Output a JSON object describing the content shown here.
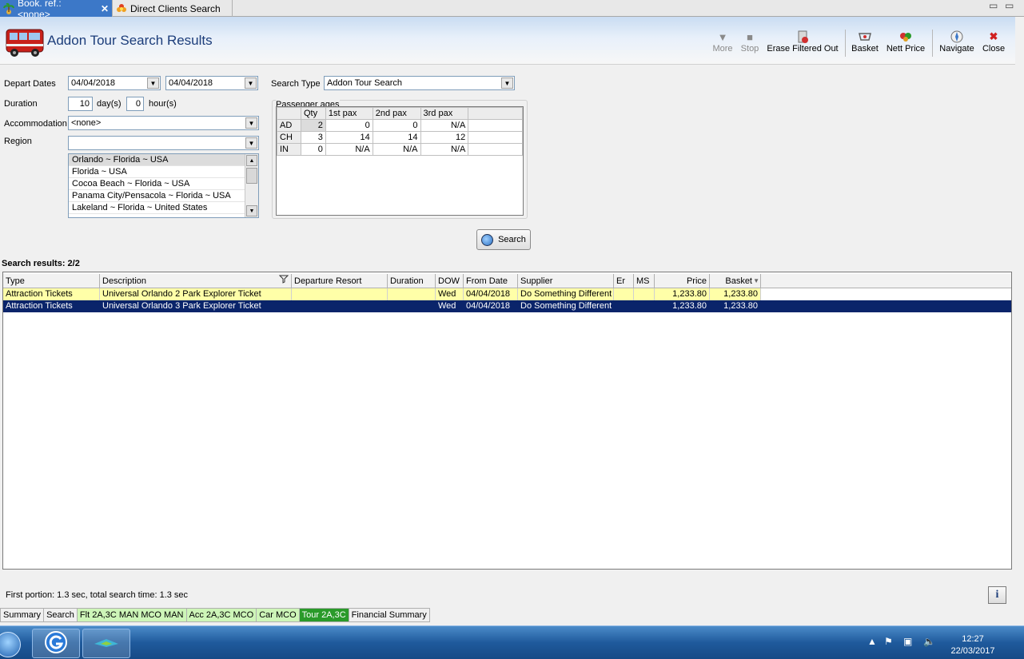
{
  "tabs": [
    {
      "label": "Book. ref.: <none>",
      "close": "✕"
    },
    {
      "label": "Direct Clients Search"
    }
  ],
  "window_controls": {
    "minimize": "▭",
    "restore": "▭"
  },
  "header": {
    "title": "Addon Tour Search Results"
  },
  "toolbar": {
    "more": "More",
    "stop": "Stop",
    "erase": "Erase Filtered Out",
    "basket": "Basket",
    "nett_price": "Nett Price",
    "navigate": "Navigate",
    "close": "Close"
  },
  "form": {
    "depart_dates_label": "Depart Dates",
    "depart_from": "04/04/2018",
    "depart_to": "04/04/2018",
    "duration_label": "Duration",
    "duration_days": "10",
    "days_unit": "day(s)",
    "duration_hours": "0",
    "hours_unit": "hour(s)",
    "accommodation_label": "Accommodation",
    "accommodation_value": "<none>",
    "region_label": "Region",
    "region_value": "",
    "search_type_label": "Search Type",
    "search_type_value": "Addon Tour Search",
    "regions": [
      "Orlando ~ Florida ~ USA",
      "Florida ~ USA",
      "Cocoa Beach ~ Florida ~ USA",
      "Panama City/Pensacola ~  Florida  ~ USA",
      "Lakeland ~ Florida ~ United States"
    ]
  },
  "passengers": {
    "group_label": "Passenger ages",
    "headers": [
      "",
      "Qty",
      "1st pax",
      "2nd pax",
      "3rd pax",
      ""
    ],
    "rows": [
      {
        "type": "AD",
        "qty": "2",
        "p1": "0",
        "p2": "0",
        "p3": "N/A"
      },
      {
        "type": "CH",
        "qty": "3",
        "p1": "14",
        "p2": "14",
        "p3": "12"
      },
      {
        "type": "IN",
        "qty": "0",
        "p1": "N/A",
        "p2": "N/A",
        "p3": "N/A"
      }
    ]
  },
  "search_button": "Search",
  "results": {
    "title": "Search results: 2/2",
    "columns": {
      "type": "Type",
      "description": "Description",
      "departure_resort": "Departure Resort",
      "duration": "Duration",
      "dow": "DOW",
      "from_date": "From Date",
      "supplier": "Supplier",
      "er": "Er",
      "ms": "MS",
      "price": "Price",
      "basket": "Basket"
    },
    "rows": [
      {
        "type": "Attraction Tickets",
        "description": "Universal Orlando 2 Park Explorer Ticket",
        "departure_resort": "",
        "duration": "",
        "dow": "Wed",
        "from_date": "04/04/2018",
        "supplier": "Do Something Different",
        "er": "",
        "ms": "",
        "price": "1,233.80",
        "basket": "1,233.80"
      },
      {
        "type": "Attraction Tickets",
        "description": "Universal Orlando 3 Park Explorer Ticket",
        "departure_resort": "",
        "duration": "",
        "dow": "Wed",
        "from_date": "04/04/2018",
        "supplier": "Do Something Different",
        "er": "",
        "ms": "",
        "price": "1,233.80",
        "basket": "1,233.80"
      }
    ]
  },
  "status": {
    "text": "First portion: 1.3 sec, total search time: 1.3 sec",
    "info": "i"
  },
  "bottom_tabs": [
    "Summary",
    "Search",
    "Flt 2A,3C MAN MCO MAN",
    "Acc 2A,3C MCO",
    "Car MCO",
    "Tour 2A,3C",
    "Financial Summary"
  ],
  "taskbar": {
    "time": "12:27",
    "date": "22/03/2017"
  },
  "colors": {
    "selected_row": "#0a246a",
    "highlight_row": "#ffffa8",
    "tab_active": "#3c78c8",
    "title": "#1c3d7a"
  }
}
